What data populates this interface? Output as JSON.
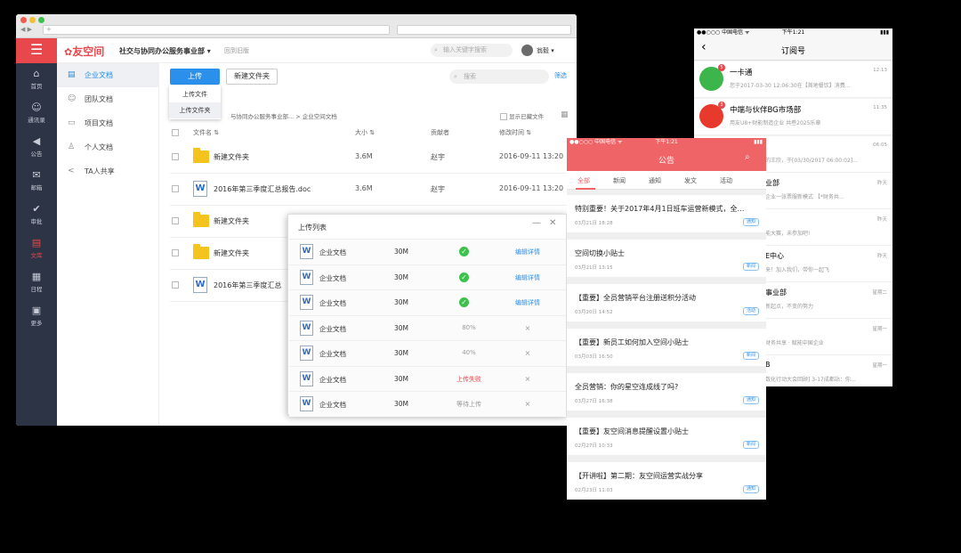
{
  "browser": {
    "url_tab": "+"
  },
  "app": {
    "logo_glyph": "☰",
    "brand": "友空间",
    "org": "社交与协同办公服务事业部",
    "back_home": "回到旧版",
    "search_placeholder": "输入关键字搜索",
    "user": "翁毅"
  },
  "sidebar": [
    {
      "icon": "home-icon",
      "glyph": "⌂",
      "label": "首页"
    },
    {
      "icon": "contacts-icon",
      "glyph": "☺",
      "label": "通讯录"
    },
    {
      "icon": "announcement-icon",
      "glyph": "◀",
      "label": "公告"
    },
    {
      "icon": "mail-icon",
      "glyph": "✉",
      "label": "邮箱"
    },
    {
      "icon": "approval-icon",
      "glyph": "✔",
      "label": "审批"
    },
    {
      "icon": "library-icon",
      "glyph": "▤",
      "label": "文库"
    },
    {
      "icon": "calendar-icon",
      "glyph": "▦",
      "label": "日程"
    },
    {
      "icon": "more-icon",
      "glyph": "▣",
      "label": "更多"
    }
  ],
  "library": [
    {
      "label": "企业文档",
      "glyph": "▤"
    },
    {
      "label": "团队文档",
      "glyph": "☺"
    },
    {
      "label": "项目文档",
      "glyph": "▭"
    },
    {
      "label": "个人文档",
      "glyph": "♙"
    },
    {
      "label": "TA人共享",
      "glyph": "<"
    }
  ],
  "toolbar": {
    "upload": "上传",
    "new_folder": "新建文件夹",
    "upload_file": "上传文件",
    "upload_folder": "上传文件夹",
    "search_placeholder": "搜索",
    "filter": "筛选",
    "breadcrumb": "与协同办公服务事业部... > 企业空间文档",
    "show_hidden": "显示已藏文件"
  },
  "table": {
    "headers": {
      "name": "文件名 ⇅",
      "size": "大小 ⇅",
      "contributor": "贡献者",
      "modified": "修改时间 ⇅"
    },
    "rows": [
      {
        "type": "folder",
        "name": "新建文件夹",
        "size": "3.6M",
        "contributor": "赵宇",
        "modified": "2016-09-11 13:20"
      },
      {
        "type": "doc",
        "name": "2016年第三季度汇总报告.doc",
        "size": "3.6M",
        "contributor": "赵宇",
        "modified": "2016-09-11 13:20"
      },
      {
        "type": "folder",
        "name": "新建文件夹",
        "size": "3.6M",
        "contributor": "赵宇",
        "modified": "2016-09-11 13:20"
      },
      {
        "type": "folder",
        "name": "新建文件夹",
        "size": "",
        "contributor": "",
        "modified": ""
      },
      {
        "type": "doc",
        "name": "2016年第三季度汇总",
        "size": "",
        "contributor": "",
        "modified": ""
      }
    ]
  },
  "upload_list": {
    "title": "上传列表",
    "items": [
      {
        "name": "企业文档",
        "size": "30M",
        "status": "✓",
        "status_type": "ok",
        "action": "编辑详情"
      },
      {
        "name": "企业文档",
        "size": "30M",
        "status": "✓",
        "status_type": "ok",
        "action": "编辑详情"
      },
      {
        "name": "企业文档",
        "size": "30M",
        "status": "✓",
        "status_type": "ok",
        "action": "编辑详情"
      },
      {
        "name": "企业文档",
        "size": "30M",
        "status": "80%",
        "status_type": "progress",
        "action": "×"
      },
      {
        "name": "企业文档",
        "size": "30M",
        "status": "40%",
        "status_type": "progress",
        "action": "×"
      },
      {
        "name": "企业文档",
        "size": "30M",
        "status": "上传失败",
        "status_type": "fail",
        "action": "×"
      },
      {
        "name": "企业文档",
        "size": "30M",
        "status": "等待上传",
        "status_type": "wait",
        "action": "×"
      }
    ]
  },
  "phone1": {
    "carrier": "●●○○○ 中国电信 ᯤ",
    "time": "下午1:21",
    "title": "订阅号",
    "items": [
      {
        "name": "一卡通",
        "sub": "您于2017-03-30 12:06:30在【首地餐饮】消费…",
        "time": "12:13",
        "badge": "5",
        "color": "#3cb54a"
      },
      {
        "name": "中端与伙伴BG市场部",
        "sub": "用友U8+财能制造企业 共叁2025乐章",
        "time": "11:35",
        "badge": "3",
        "color": "#e83a2c"
      }
    ],
    "peek": [
      {
        "title": "",
        "sub": "的王欣，于[03/30/2017 06:00:02]…",
        "time": "06:05"
      },
      {
        "title": "业部",
        "sub": "企业一张票服新模式 【*财务共…",
        "time": "昨天"
      },
      {
        "title": "",
        "sub": "能大赛，未参加吧!",
        "time": "昨天"
      },
      {
        "title": "E中心",
        "sub": "来！加入我们，带你一起飞",
        "time": "昨天"
      },
      {
        "title": "事业部",
        "sub": "新起点，不变的努力",
        "time": "星期二"
      },
      {
        "title": "",
        "sub": "财务共享 · 赋能中国企业",
        "time": "星期一"
      },
      {
        "title": "B",
        "sub": "数化行动大会回顾] 3-17成都站：你…",
        "time": "星期一"
      }
    ]
  },
  "phone2": {
    "carrier": "●●○○○ 中国电信 ᯤ",
    "time": "下午1:21",
    "title": "公告",
    "tabs": [
      "全部",
      "新闻",
      "通知",
      "发文",
      "活动"
    ],
    "cards": [
      {
        "title": "特别重要！关于2017年4月1日班车运营新模式，全…",
        "date": "03月21日 18:28",
        "tag": "通知"
      },
      {
        "title": "空间切换小贴士",
        "date": "03月21日 13:15",
        "tag": "新闻"
      },
      {
        "title": "【重要】全员营销平台注册送积分活动",
        "date": "03月20日 14:52",
        "tag": "活动"
      },
      {
        "title": "【重要】新员工如何加入空间小贴士",
        "date": "03月03日 16:50",
        "tag": "新闻"
      },
      {
        "title": "全员营销：你的星空连成线了吗?",
        "date": "03月27日 16:38",
        "tag": "通知"
      },
      {
        "title": "【重要】友空间消息提醒设置小贴士",
        "date": "02月27日 10:33",
        "tag": "新闻"
      },
      {
        "title": "【开讲啦】第二期：友空间运营实战分享",
        "date": "02月23日 11:03",
        "tag": "通知"
      }
    ]
  }
}
